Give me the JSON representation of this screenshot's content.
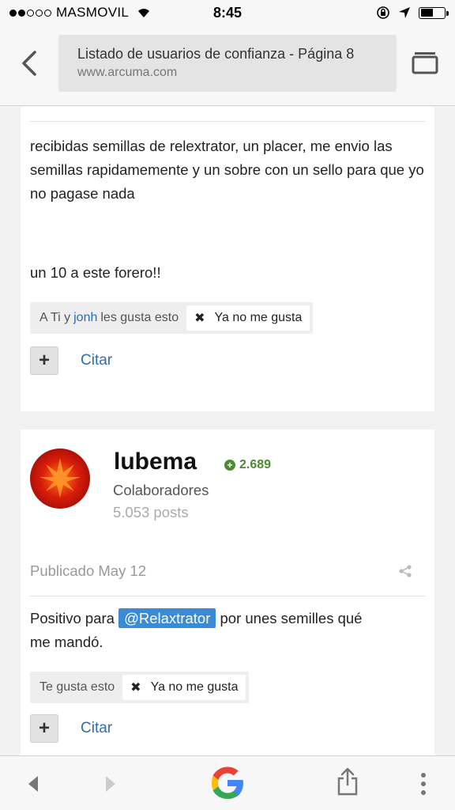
{
  "status": {
    "carrier": "MASMOVIL",
    "time": "8:45"
  },
  "browser": {
    "page_title": "Listado de usuarios de confianza - Página 8",
    "domain": "www.arcuma.com"
  },
  "post1": {
    "paragraph1": "recibidas semillas de relextrator, un placer, me envio las semillas rapidamemente y un sobre con un sello para que yo no pagase nada",
    "paragraph2": "un 10 a este forero!!",
    "likes": {
      "prefix": "A Ti y ",
      "user": "jonh",
      "suffix": " les gusta esto",
      "unlike_label": "Ya no me gusta"
    },
    "quote_label": "Citar"
  },
  "post2": {
    "author": "lubema",
    "reputation": "2.689",
    "group": "Colaboradores",
    "post_count": "5.053 posts",
    "published": "Publicado May 12",
    "text_before": "Positivo para ",
    "mention": "@Relaxtrator",
    "text_after": " por unes semilles qué me mandó.",
    "likes": {
      "text": "Te gusta esto",
      "unlike_label": "Ya no me gusta"
    },
    "quote_label": "Citar"
  },
  "colors": {
    "link": "#2e6db0",
    "reputation": "#4e8a32",
    "mention_bg": "#3b8bd4"
  },
  "icons": [
    "back-arrow-icon",
    "tabs-icon",
    "wifi-icon",
    "lock-rotation-icon",
    "location-arrow-icon",
    "battery-icon",
    "plus-icon",
    "share-icon",
    "google-icon",
    "share-upload-icon",
    "more-vertical-icon"
  ]
}
